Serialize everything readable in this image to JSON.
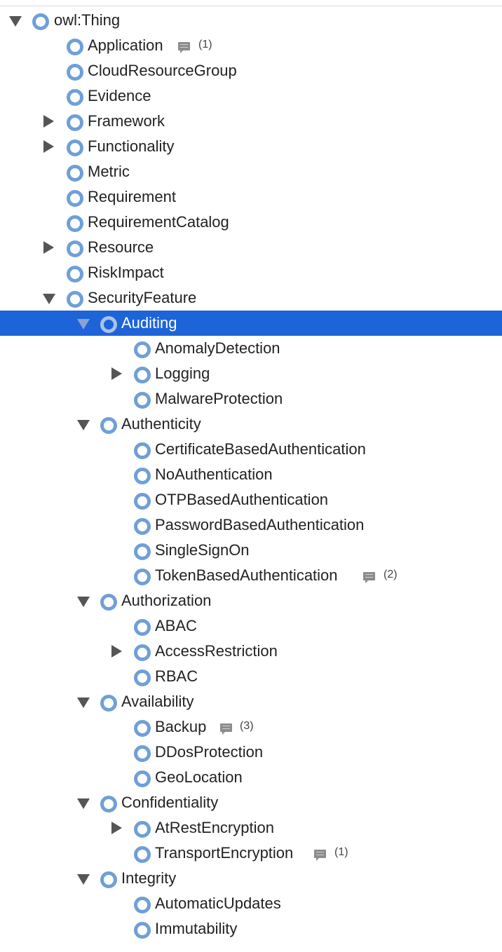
{
  "tree": {
    "root": "owl:Thing",
    "items": [
      {
        "label": "Application",
        "comments": "(1)"
      },
      {
        "label": "CloudResourceGroup"
      },
      {
        "label": "Evidence"
      },
      {
        "label": "Framework"
      },
      {
        "label": "Functionality"
      },
      {
        "label": "Metric"
      },
      {
        "label": "Requirement"
      },
      {
        "label": "RequirementCatalog"
      },
      {
        "label": "Resource"
      },
      {
        "label": "RiskImpact"
      },
      {
        "label": "SecurityFeature"
      },
      {
        "label": "Auditing",
        "selected": true
      },
      {
        "label": "AnomalyDetection"
      },
      {
        "label": "Logging"
      },
      {
        "label": "MalwareProtection"
      },
      {
        "label": "Authenticity"
      },
      {
        "label": "CertificateBasedAuthentication"
      },
      {
        "label": "NoAuthentication"
      },
      {
        "label": "OTPBasedAuthentication"
      },
      {
        "label": "PasswordBasedAuthentication"
      },
      {
        "label": "SingleSignOn"
      },
      {
        "label": "TokenBasedAuthentication",
        "comments": "(2)"
      },
      {
        "label": "Authorization"
      },
      {
        "label": "ABAC"
      },
      {
        "label": "AccessRestriction"
      },
      {
        "label": "RBAC"
      },
      {
        "label": "Availability"
      },
      {
        "label": "Backup",
        "comments": "(3)"
      },
      {
        "label": "DDosProtection"
      },
      {
        "label": "GeoLocation"
      },
      {
        "label": "Confidentiality"
      },
      {
        "label": "AtRestEncryption"
      },
      {
        "label": "TransportEncryption",
        "comments": "(1)"
      },
      {
        "label": "Integrity"
      },
      {
        "label": "AutomaticUpdates"
      },
      {
        "label": "Immutability"
      }
    ]
  },
  "colors": {
    "selection": "#1d64d8",
    "node": "#6f9fd8",
    "arrow": "#555555",
    "comment": "#8c8c8c"
  },
  "icons": {
    "node": "class-node-icon",
    "expanded": "expanded-triangle-icon",
    "collapsed": "collapsed-triangle-icon",
    "comment": "comment-icon"
  }
}
